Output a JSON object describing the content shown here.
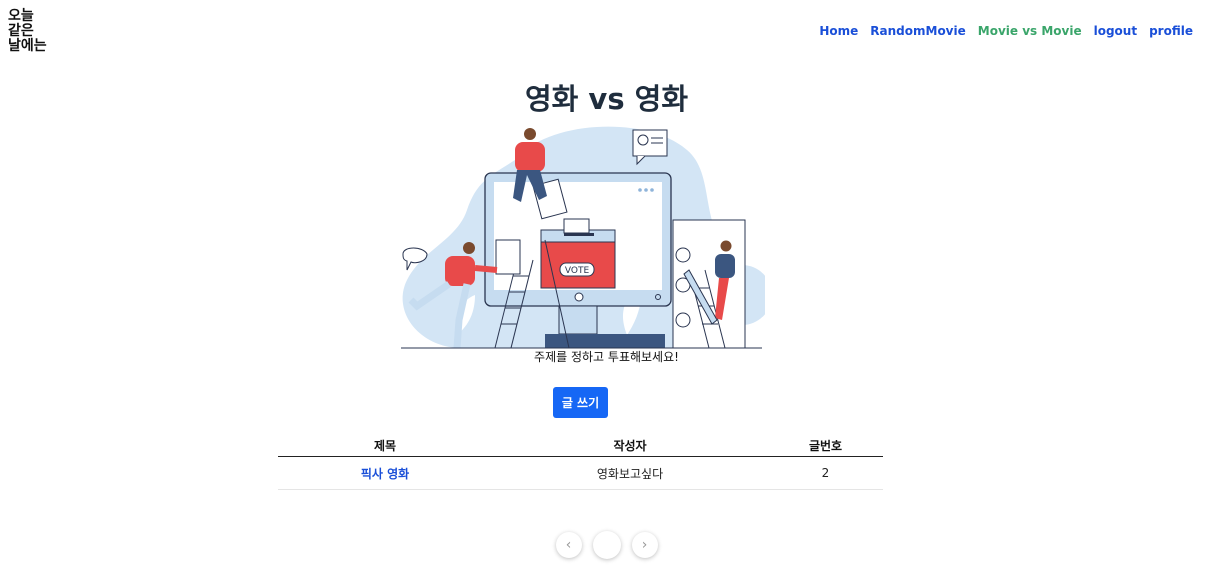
{
  "brand": {
    "logo_text": "오늘\n같은\n날에는"
  },
  "nav": {
    "items": [
      {
        "label": "Home",
        "active": false
      },
      {
        "label": "RandomMovie",
        "active": false
      },
      {
        "label": "Movie vs Movie",
        "active": true
      },
      {
        "label": "logout",
        "active": false
      },
      {
        "label": "profile",
        "active": false
      }
    ]
  },
  "main": {
    "title": "영화 vs 영화",
    "illustration": {
      "ballot_text": "VOTE"
    },
    "caption": "주제를 정하고 투표해보세요!",
    "write_button": "글 쓰기"
  },
  "table": {
    "headers": [
      "제목",
      "작성자",
      "글번호"
    ],
    "rows": [
      {
        "title": "픽사 영화",
        "author": "영화보고싶다",
        "number": "2"
      }
    ]
  },
  "pagination": {
    "prev_icon": "chevron-left-icon",
    "next_icon": "chevron-right-icon",
    "current_page": ""
  },
  "colors": {
    "accent": "#1667f5",
    "nav_link": "#1a4fd8",
    "nav_active": "#3aa56a",
    "ballot_red": "#e84a4a",
    "illustration_blue": "#cfe3f5"
  }
}
